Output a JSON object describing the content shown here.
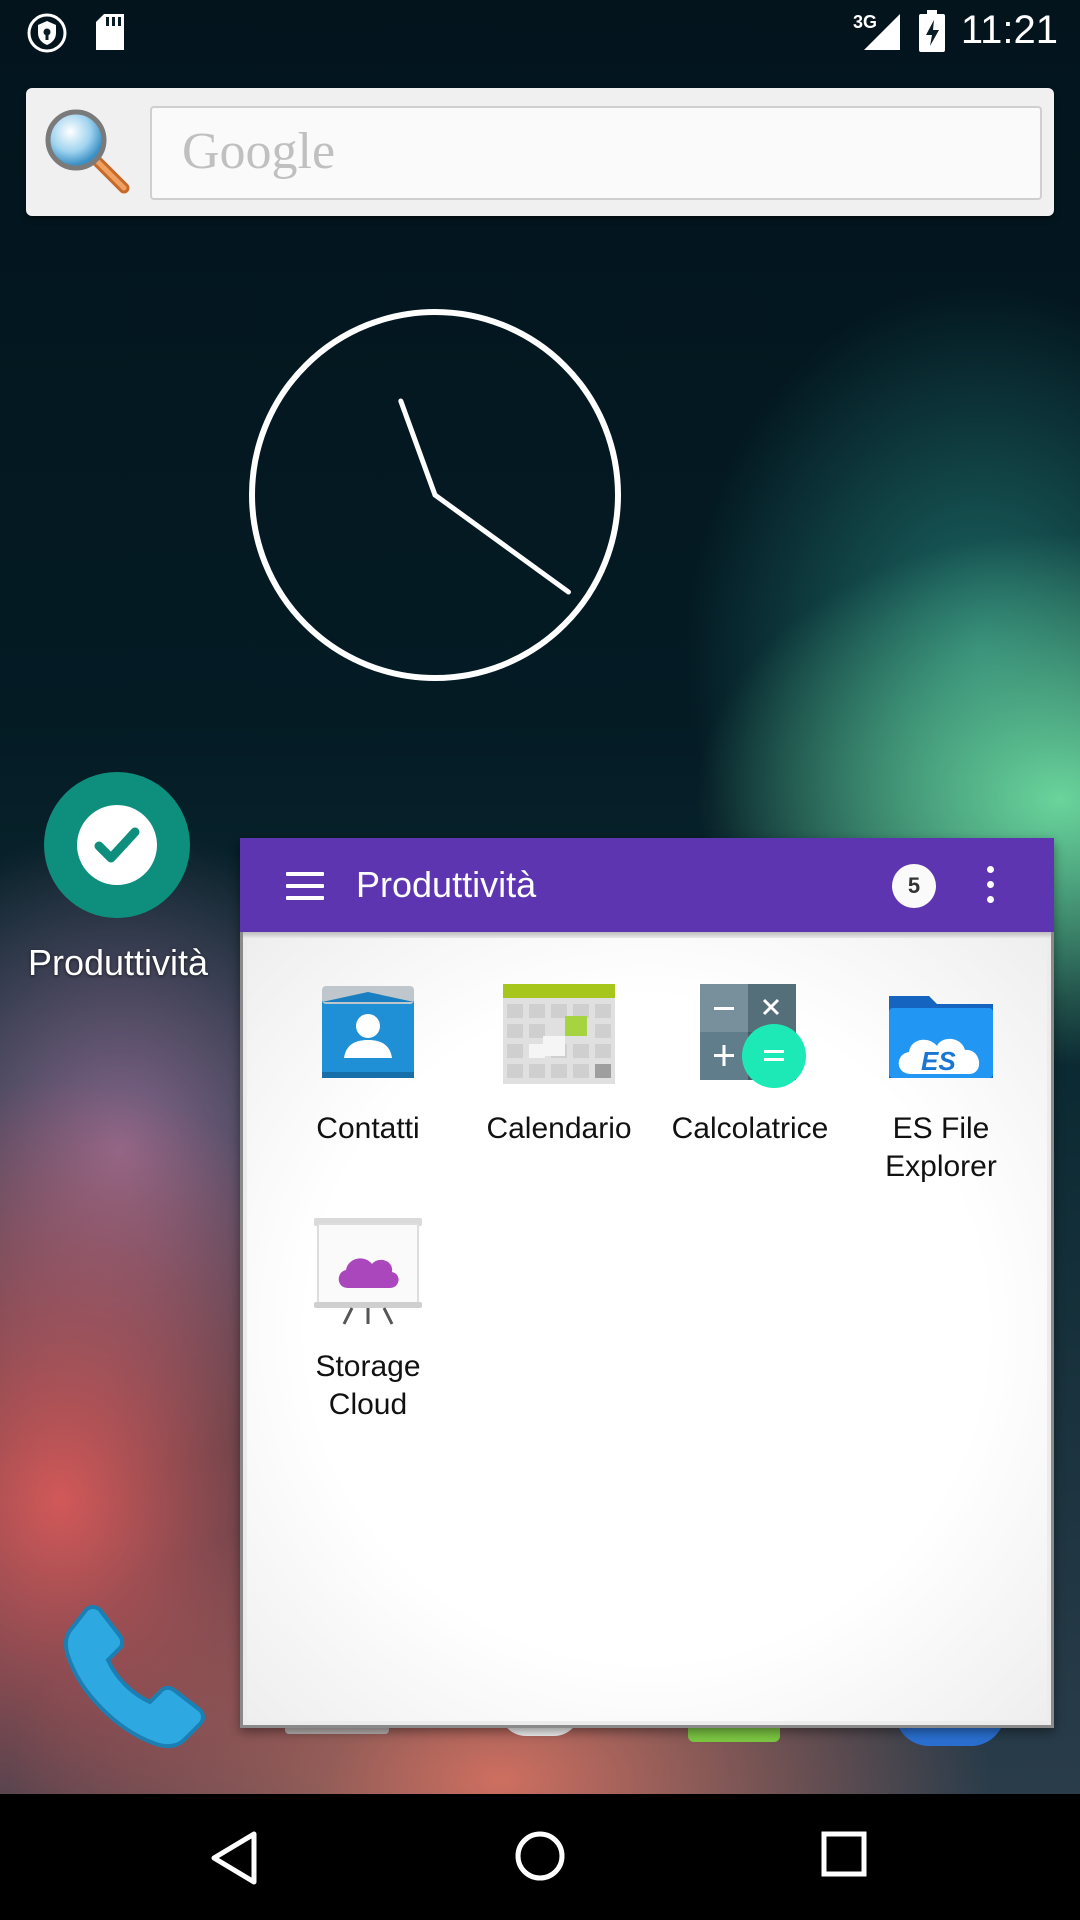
{
  "status_bar": {
    "time": "11:21",
    "network": "3G",
    "icons": [
      "vpn-shield-icon",
      "sd-card-icon",
      "signal-icon",
      "battery-charging-icon"
    ]
  },
  "search": {
    "placeholder": "Google",
    "icon": "magnifier-icon"
  },
  "clock": {
    "hour_hand_angle_deg": -20,
    "minute_hand_angle_deg": 126
  },
  "desktop": {
    "folder_label": "Produttività",
    "folder_icon": "check-circle-icon",
    "phone_icon": "phone-icon"
  },
  "folder_panel": {
    "title": "Produttività",
    "badge_count": "5",
    "apps": [
      {
        "label": "Contatti",
        "icon": "contacts-icon"
      },
      {
        "label": "Calendario",
        "icon": "calendar-icon"
      },
      {
        "label": "Calcolatrice",
        "icon": "calculator-icon"
      },
      {
        "label": "ES File Explorer",
        "icon": "es-file-explorer-icon"
      },
      {
        "label": "Storage Cloud",
        "icon": "storage-cloud-icon"
      }
    ]
  },
  "colors": {
    "folder_header": "#5e35b1",
    "folder_icon_bg": "#0e8f7e",
    "accent_teal": "#1de9b6"
  },
  "navigation": {
    "back": "back-icon",
    "home": "home-icon",
    "recents": "recents-icon"
  }
}
